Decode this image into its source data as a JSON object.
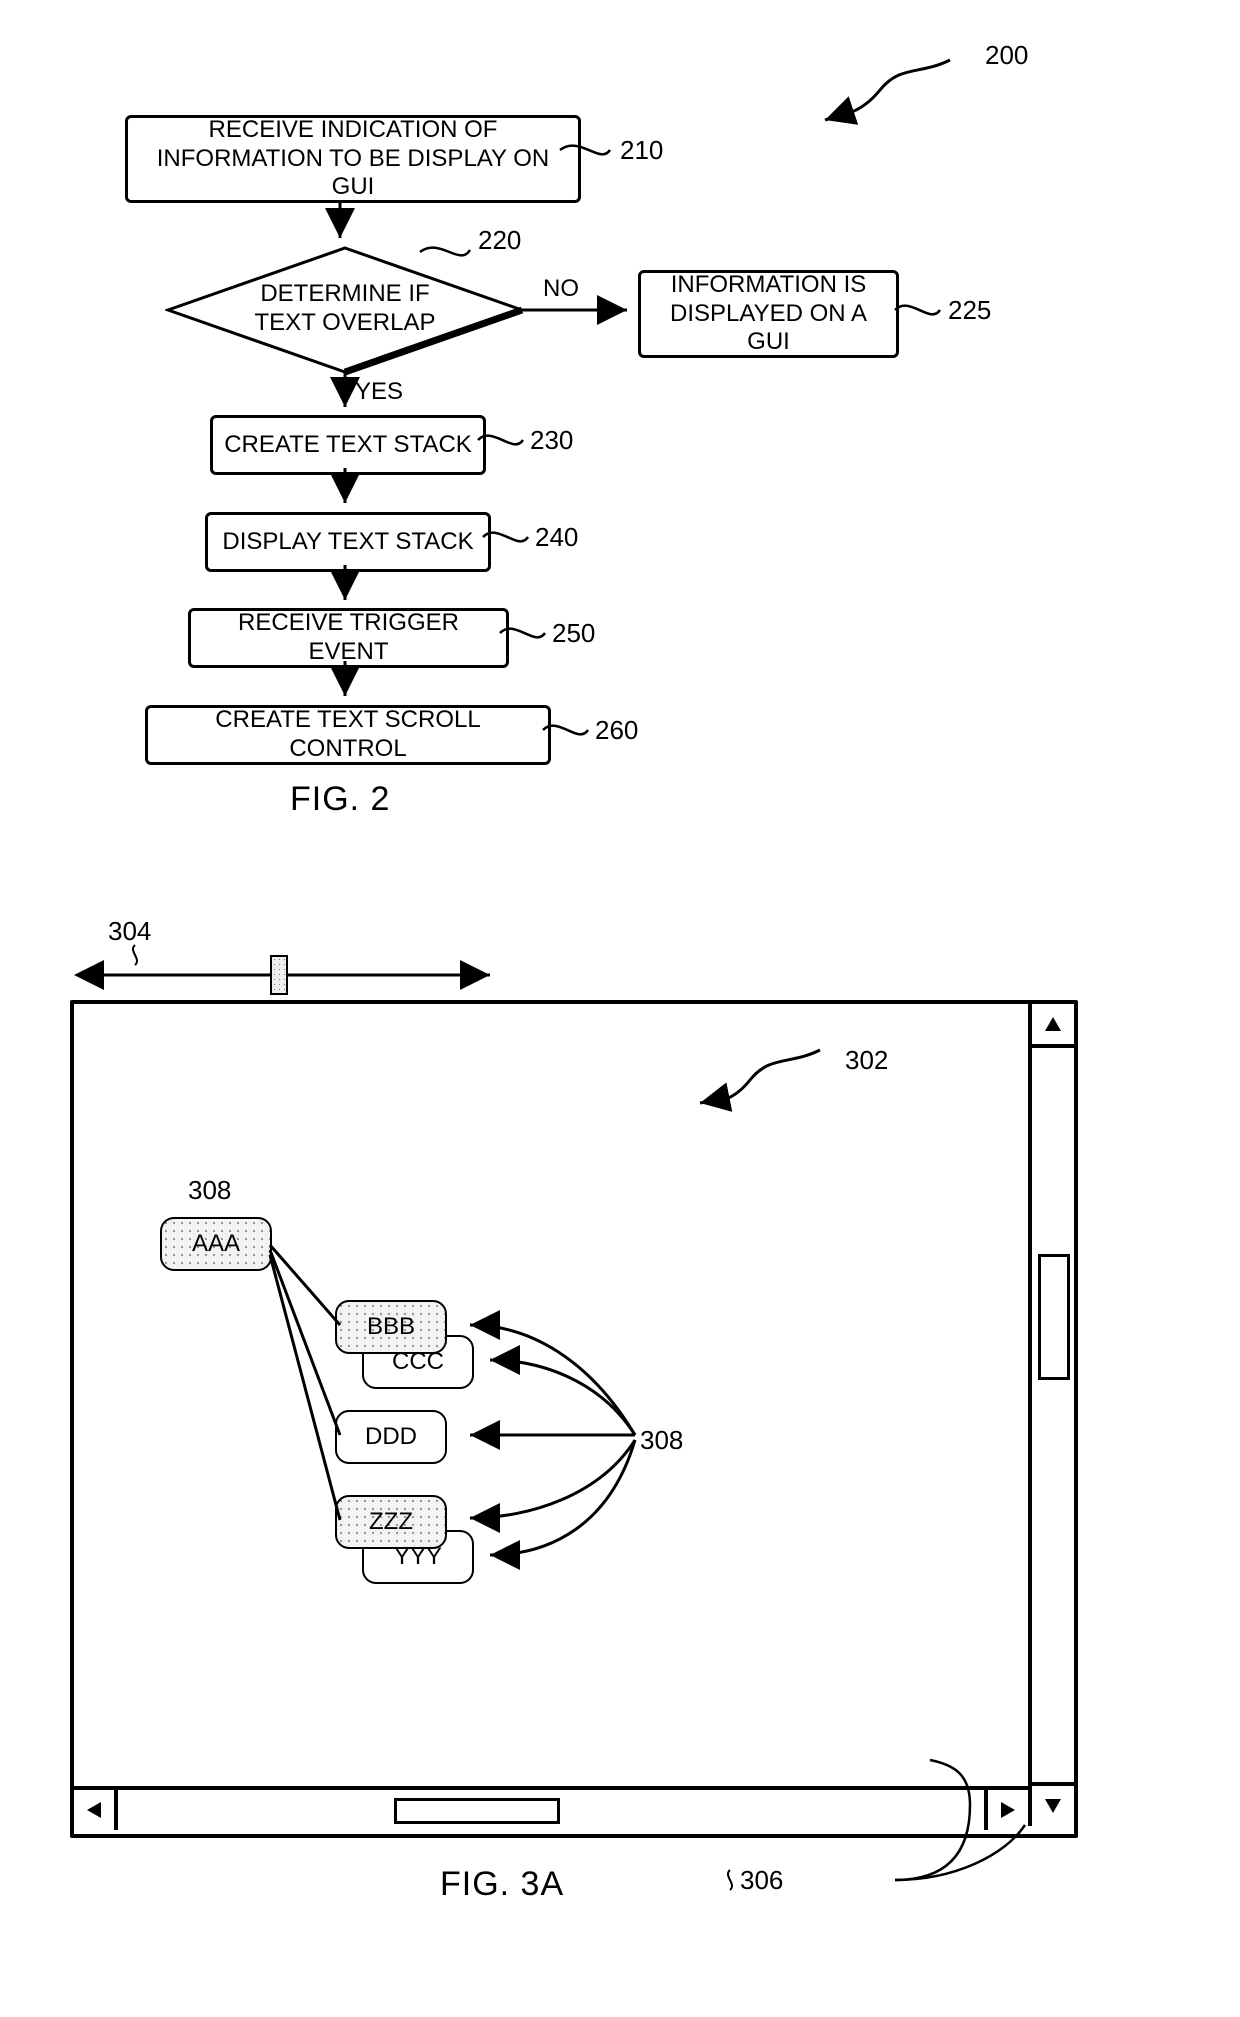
{
  "fig2": {
    "caption": "FIG. 2",
    "ref_diagram": "200",
    "steps": {
      "s210": {
        "text": "RECEIVE INDICATION OF\nINFORMATION TO BE DISPLAY ON GUI",
        "ref": "210"
      },
      "s220": {
        "text": "DETERMINE IF\nTEXT OVERLAP",
        "ref": "220",
        "yes": "YES",
        "no": "NO"
      },
      "s225": {
        "text": "INFORMATION IS\nDISPLAYED ON A GUI",
        "ref": "225"
      },
      "s230": {
        "text": "CREATE TEXT STACK",
        "ref": "230"
      },
      "s240": {
        "text": "DISPLAY TEXT STACK",
        "ref": "240"
      },
      "s250": {
        "text": "RECEIVE TRIGGER EVENT",
        "ref": "250"
      },
      "s260": {
        "text": "CREATE TEXT SCROLL CONTROL",
        "ref": "260"
      }
    }
  },
  "fig3a": {
    "caption": "FIG. 3A",
    "ref_window": "302",
    "ref_slider": "304",
    "ref_scrollbars": "306",
    "ref_nodes": "308",
    "ref_nodes_left": "308",
    "nodes": {
      "aaa": "AAA",
      "bbb": "BBB",
      "ccc": "CCC",
      "ddd": "DDD",
      "zzz": "ZZZ",
      "yyy": "YYY"
    }
  }
}
